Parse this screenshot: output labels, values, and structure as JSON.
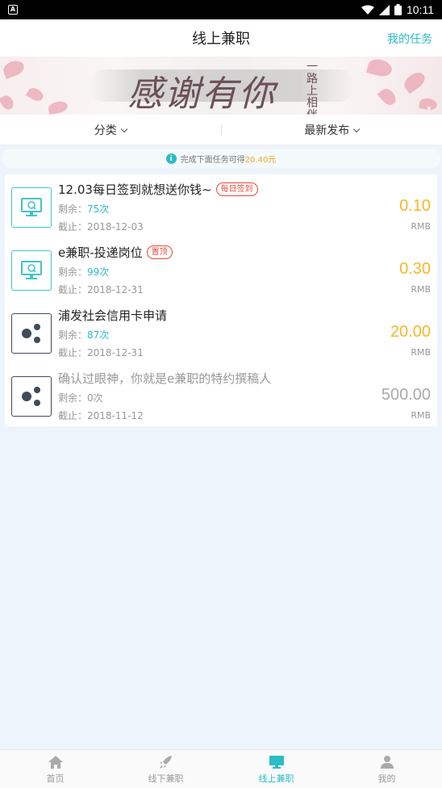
{
  "status_bar": {
    "time": "10:11"
  },
  "header": {
    "title": "线上兼职",
    "right_action": "我的任务"
  },
  "banner": {
    "calligraphy": "感谢有你",
    "vertical_text": "一路上相伴"
  },
  "filters": [
    {
      "label": "分类"
    },
    {
      "label": "最新发布"
    }
  ],
  "notice": {
    "text": "完成下面任务可得",
    "amount": "20.40元"
  },
  "tasks": [
    {
      "title": "12.03每日签到就想送你钱~",
      "tag": "每日签到",
      "remain_label": "剩余：",
      "remain_value": "75次",
      "deadline": "截止：2018-12-03",
      "price": "0.10",
      "unit": "RMB",
      "icon": "monitor-refresh-icon",
      "state": "active"
    },
    {
      "title": "e兼职-投递岗位",
      "tag": "置顶",
      "remain_label": "剩余：",
      "remain_value": "99次",
      "deadline": "截止：2018-12-31",
      "price": "0.30",
      "unit": "RMB",
      "icon": "monitor-refresh-icon",
      "state": "active"
    },
    {
      "title": "浦发社会信用卡申请",
      "tag": "",
      "remain_label": "剩余：",
      "remain_value": "87次",
      "deadline": "截止：2018-12-31",
      "price": "20.00",
      "unit": "RMB",
      "icon": "share-dots-icon",
      "state": "active"
    },
    {
      "title": "确认过眼神，你就是e兼职的特约撰稿人",
      "tag": "",
      "remain_label": "剩余：",
      "remain_value": "0次",
      "deadline": "截止：2018-11-12",
      "price": "500.00",
      "unit": "RMB",
      "icon": "share-dots-icon",
      "state": "expired"
    }
  ],
  "tabbar": [
    {
      "label": "首页",
      "icon": "home-icon",
      "active": false
    },
    {
      "label": "线下兼职",
      "icon": "rocket-icon",
      "active": false
    },
    {
      "label": "线上兼职",
      "icon": "monitor-icon",
      "active": true
    },
    {
      "label": "我的",
      "icon": "user-icon",
      "active": false
    }
  ],
  "colors": {
    "accent": "#2bbcc7",
    "price": "#f5b72a",
    "tag": "#e8493e"
  }
}
